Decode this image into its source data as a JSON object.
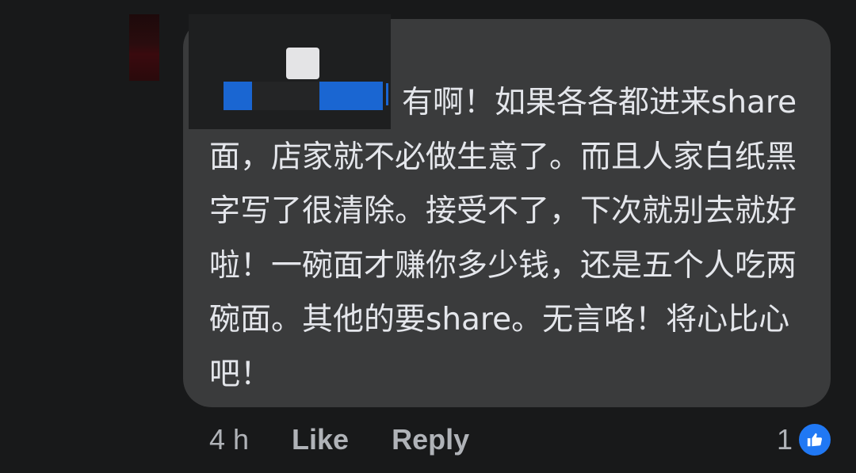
{
  "comment": {
    "text": "有啊！如果各各都进来share面，店家就不必做生意了。而且人家白纸黑字写了很清除。接受不了，下次就别去就好啦！一碗面才赚你多少钱，还是五个人吃两碗面。其他的要share。无言咯！将心比心吧！"
  },
  "actions": {
    "time": "4 h",
    "like_label": "Like",
    "reply_label": "Reply"
  },
  "reactions": {
    "count": "1",
    "icon": "thumbs-up-icon",
    "color": "#2078f4"
  },
  "colors": {
    "background": "#18191a",
    "bubble": "#3a3b3c",
    "text": "#e4e6eb",
    "muted": "#b0b3b8"
  }
}
